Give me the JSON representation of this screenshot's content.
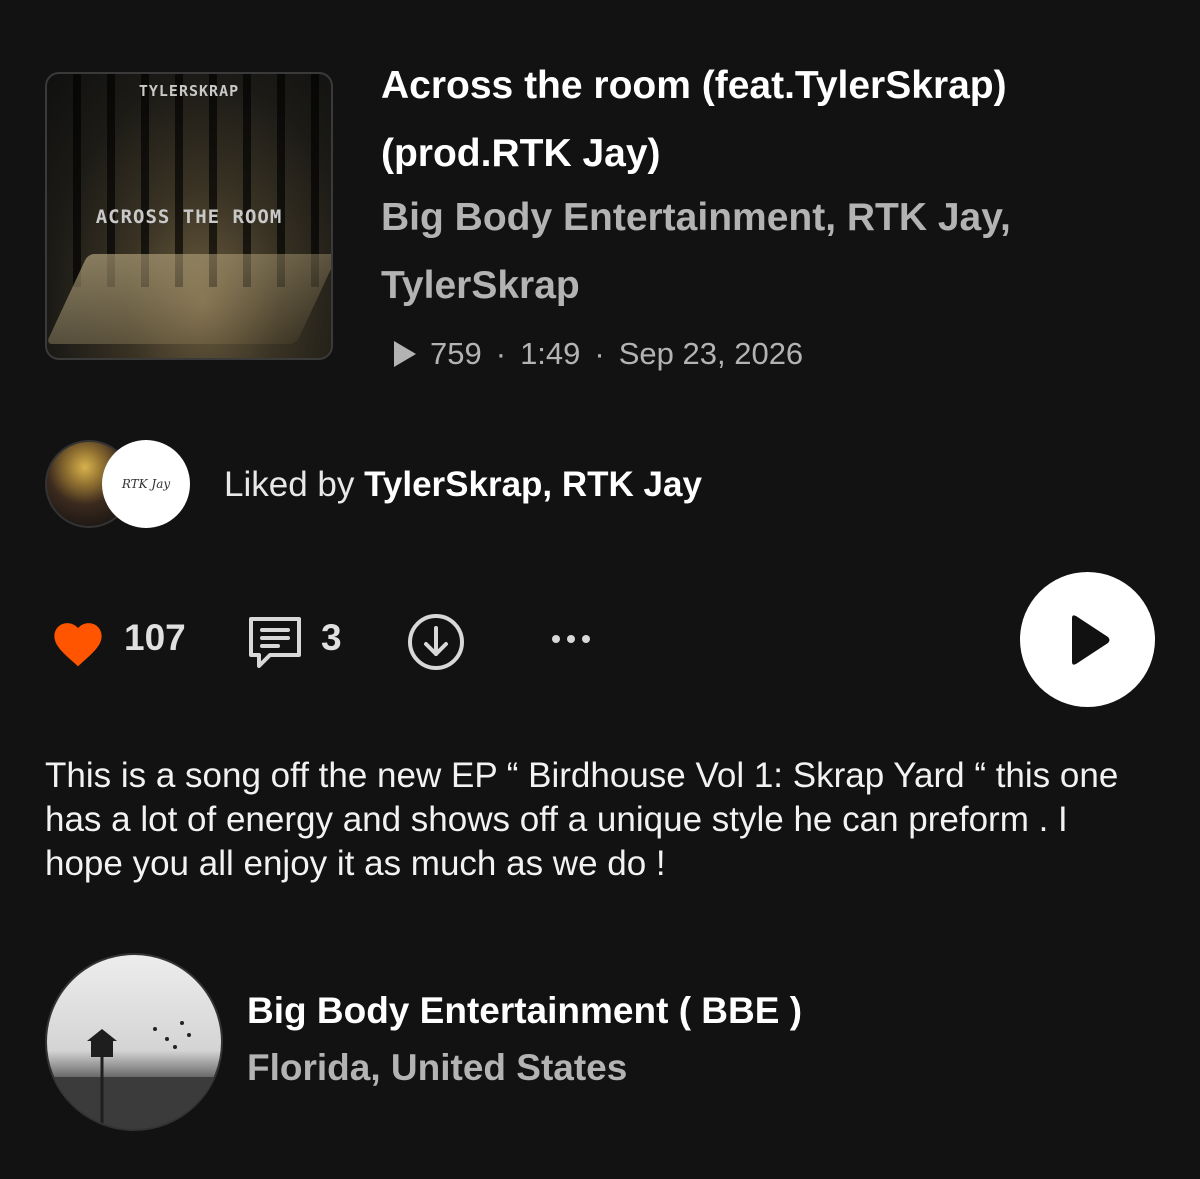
{
  "track": {
    "artwork_top_text": "TYLERSKRAP",
    "artwork_title_text": "ACROSS THE ROOM",
    "title": "Across the room (feat.TylerSkrap) (prod.RTK Jay)",
    "artists": "Big Body Entertainment, RTK Jay, TylerSkrap",
    "plays": "759",
    "duration": "1:49",
    "date": "Sep 23, 2026",
    "separator": "·"
  },
  "liked_by": {
    "prefix": "Liked by ",
    "names": "TylerSkrap, RTK Jay",
    "avatar_b_text": "RTK Jay"
  },
  "actions": {
    "like_count": "107",
    "comment_count": "3",
    "heart_color": "#ff5500",
    "icons": [
      "heart-icon",
      "comment-icon",
      "download-icon",
      "more-icon",
      "play-icon"
    ]
  },
  "description": "This is a song off the new EP “ Birdhouse Vol 1: Skrap Yard “ this one has a lot of energy and shows off a unique style he can preform . I hope you all enjoy it as much as we do !",
  "uploader": {
    "name": "Big Body Entertainment ( BBE )",
    "location": "Florida, United States"
  }
}
